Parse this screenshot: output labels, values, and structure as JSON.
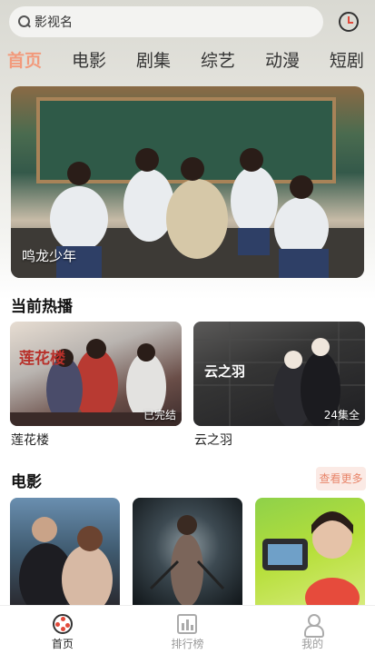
{
  "search": {
    "placeholder": "影视名"
  },
  "tabs": [
    {
      "label": "首页"
    },
    {
      "label": "电影"
    },
    {
      "label": "剧集"
    },
    {
      "label": "综艺"
    },
    {
      "label": "动漫"
    },
    {
      "label": "短剧"
    }
  ],
  "banner": {
    "title": "鸣龙少年"
  },
  "now_playing": {
    "title": "当前热播",
    "items": [
      {
        "name": "莲花楼",
        "status": "已完结",
        "logo": "莲花楼"
      },
      {
        "name": "云之羽",
        "status": "24集全",
        "logo": "云之羽"
      }
    ]
  },
  "movies": {
    "title": "电影",
    "more_label": "查看更多"
  },
  "bottom_nav": [
    {
      "label": "首页"
    },
    {
      "label": "排行榜"
    },
    {
      "label": "我的"
    }
  ],
  "colors": {
    "accent": "#f29a7c",
    "more_bg": "#fbeae5",
    "icon_red": "#e24a3b"
  }
}
